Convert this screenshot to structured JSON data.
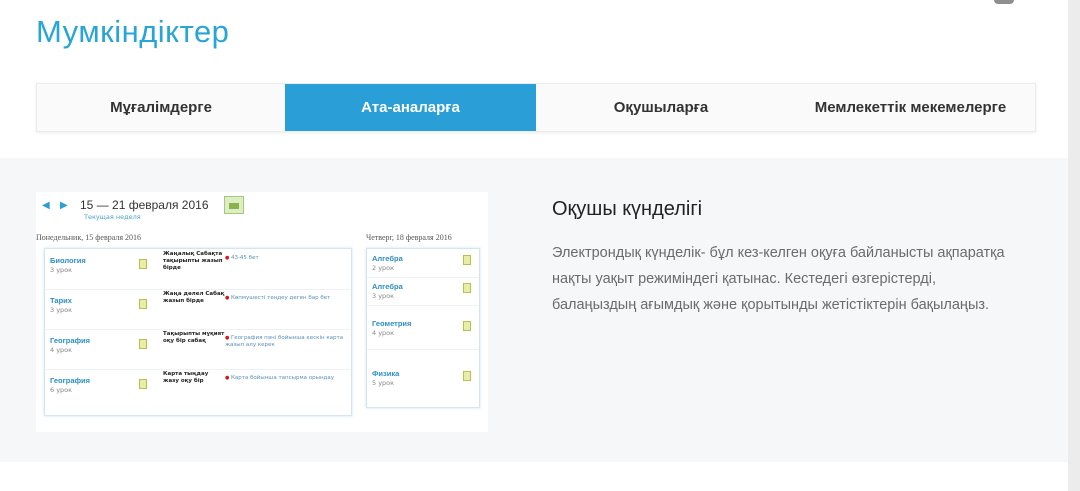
{
  "page": {
    "title": "Мумкіндіктер"
  },
  "tabs": [
    {
      "label": "Мұғалімдерге",
      "active": false
    },
    {
      "label": "Ата-аналарға",
      "active": true
    },
    {
      "label": "Оқушыларға",
      "active": false
    },
    {
      "label": "Мемлекеттік мекемелерге",
      "active": false
    }
  ],
  "preview": {
    "prev_icon": "◀",
    "next_icon": "▶",
    "range": "15 — 21 февраля 2016",
    "current_week": "Текущая неделя",
    "left_day": {
      "date": "Понедельник, 15 февраля 2016",
      "rows": [
        {
          "subject": "Биология",
          "lessons": "3 урок",
          "homework": "Жаңалық Сабақта тақырыпты жазып бірде",
          "task": "43-45 бет"
        },
        {
          "subject": "Тарих",
          "lessons": "3 урок",
          "homework": "Жаңа дәлел Сабақ жазып бірде",
          "task": "Көпмүшесті теңдеу деген бар бет"
        },
        {
          "subject": "География",
          "lessons": "4 урок",
          "homework": "Тақырыпты мұқият оқу бір сабақ",
          "task": "География пәні бойынша кескін карта жазып алу керек"
        },
        {
          "subject": "География",
          "lessons": "6 урок",
          "homework": "Карта тыңдау жазу оқу бір",
          "task": "Карта бойынша тапсырма орындау"
        }
      ]
    },
    "right_day": {
      "date": "Четверг, 18 февраля 2016",
      "rows": [
        {
          "subject": "Алгебра",
          "lessons": "2 урок"
        },
        {
          "subject": "Алгебра",
          "lessons": "3 урок"
        },
        {
          "subject": "Геометрия",
          "lessons": "4 урок"
        },
        {
          "subject": "Физика",
          "lessons": "5 урок"
        }
      ]
    }
  },
  "description": {
    "title": "Оқушы күнделігі",
    "body": "Электрондық күнделік- бұл кез-келген оқуға байланысты ақпаратқа нақты уақыт режиміндегі қатынас. Кестедегі өзгерістерді, балаңыздың ағымдық және қорытынды жетістіктерін бақылаңыз."
  },
  "colors": {
    "accent": "#27a5d6",
    "active_tab": "#2a9ed6"
  }
}
